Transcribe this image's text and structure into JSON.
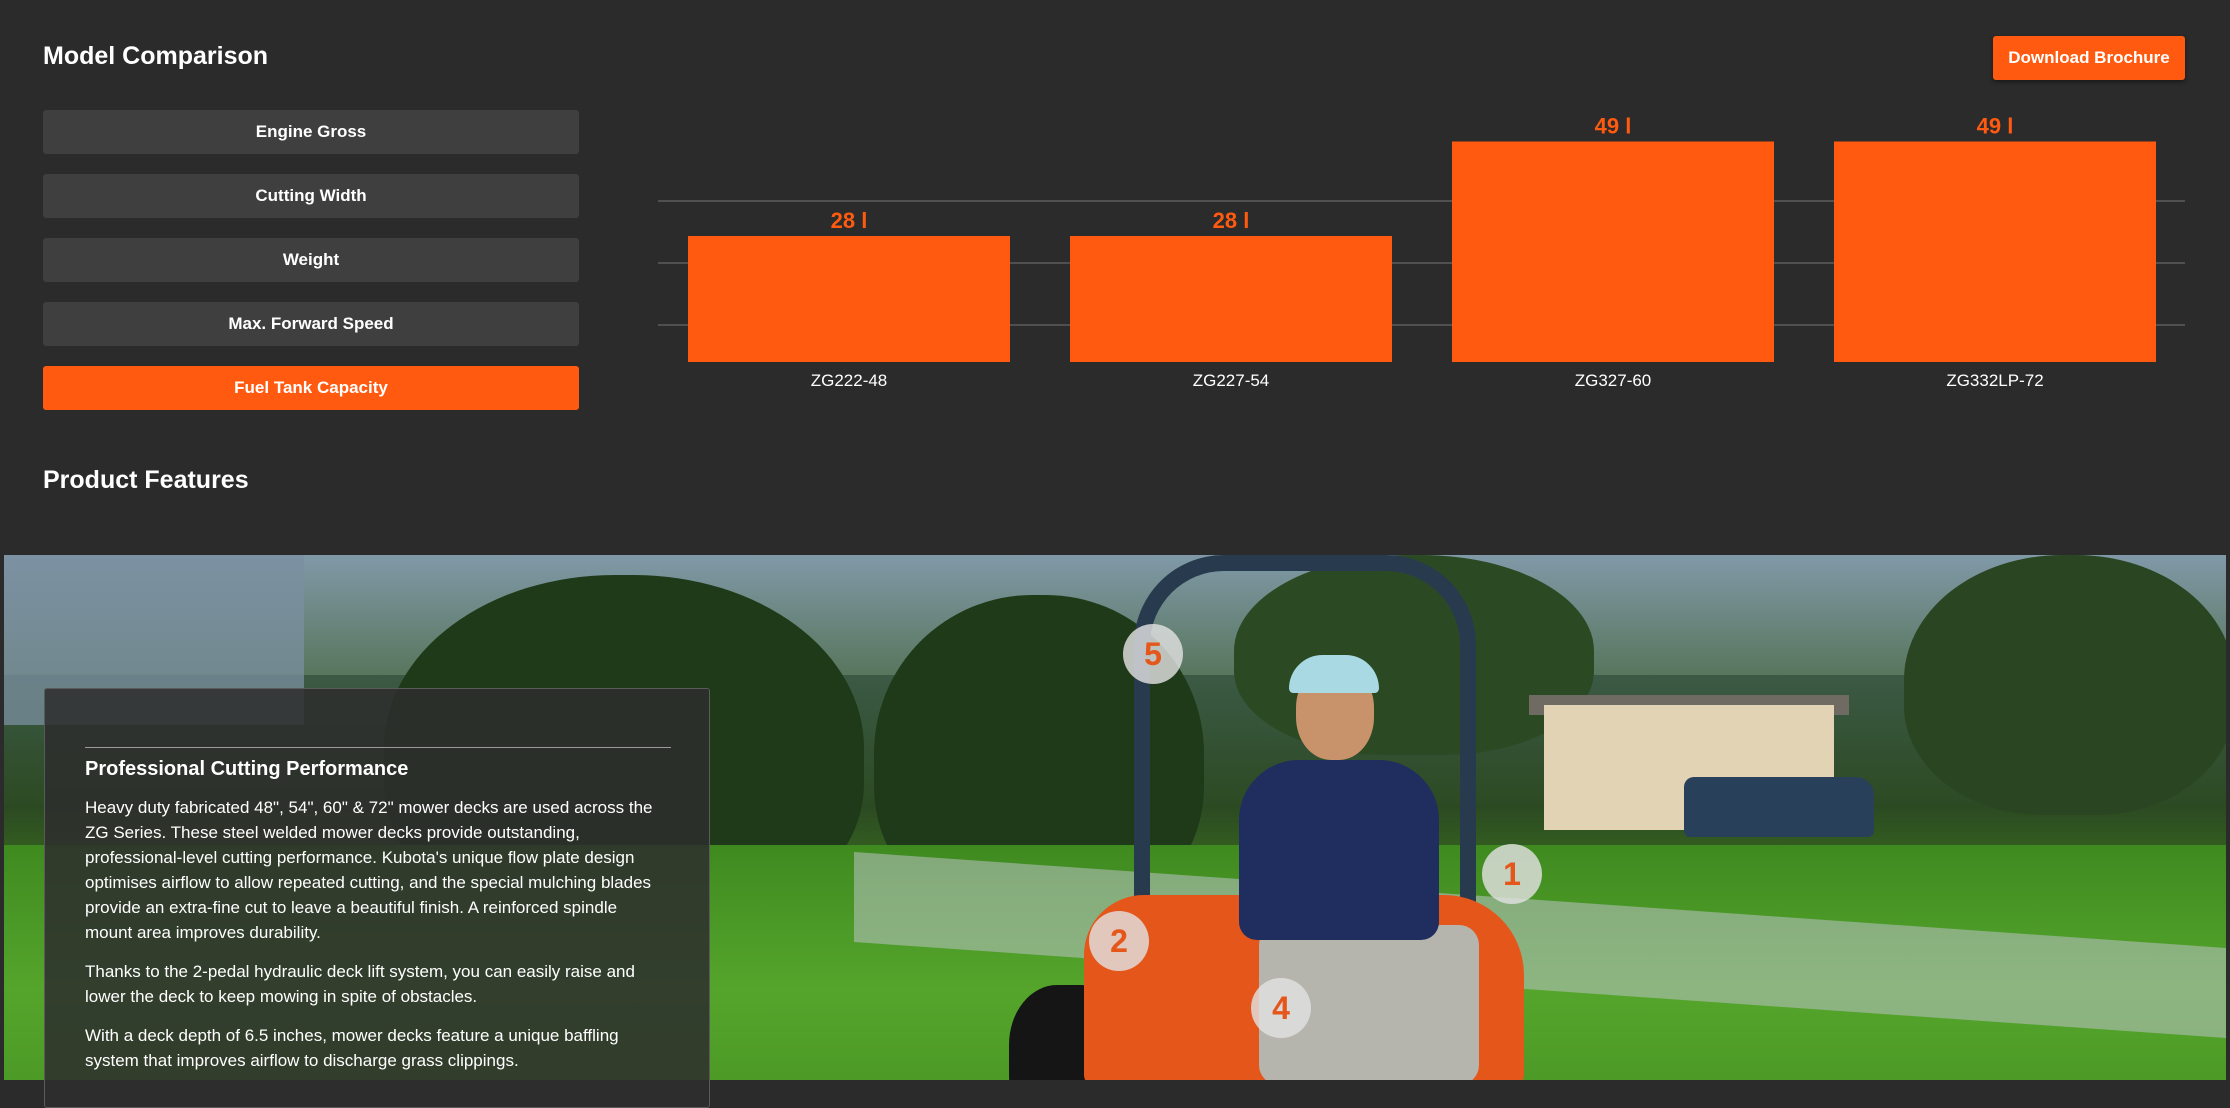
{
  "comparison": {
    "title": "Model Comparison",
    "download_label": "Download Brochure",
    "filters": [
      {
        "label": "Engine Gross",
        "active": false
      },
      {
        "label": "Cutting Width",
        "active": false
      },
      {
        "label": "Weight",
        "active": false
      },
      {
        "label": "Max. Forward Speed",
        "active": false
      },
      {
        "label": "Fuel Tank Capacity",
        "active": true
      }
    ]
  },
  "chart_data": {
    "type": "bar",
    "categories": [
      "ZG222-48",
      "ZG227-54",
      "ZG327-60",
      "ZG332LP-72"
    ],
    "values": [
      28,
      28,
      49,
      49
    ],
    "value_labels": [
      "28 l",
      "28 l",
      "49 l",
      "49 l"
    ],
    "unit": "l",
    "title": "",
    "xlabel": "",
    "ylabel": "",
    "grid": true,
    "color": "#ff5a0f"
  },
  "features": {
    "title": "Product Features",
    "hotspots": [
      "1",
      "2",
      "4",
      "5"
    ],
    "card": {
      "title": "Professional Cutting Performance",
      "paragraphs": [
        "Heavy duty fabricated 48\", 54\", 60\" & 72\" mower decks are used across the ZG Series. These steel welded mower decks provide outstanding, professional-level cutting performance. Kubota's unique flow plate design optimises airflow to allow repeated cutting, and the special mulching blades provide an extra-fine cut to leave a beautiful finish. A reinforced spindle mount area improves durability.",
        "Thanks to the 2-pedal hydraulic deck lift system, you can easily raise and lower the deck to keep mowing in spite of obstacles.",
        "With a deck depth of 6.5 inches, mower decks feature a unique baffling system that improves airflow to discharge grass clippings."
      ]
    }
  },
  "colors": {
    "accent": "#ff5a0f",
    "background": "#2b2b2b",
    "button": "#3f3f3f"
  }
}
